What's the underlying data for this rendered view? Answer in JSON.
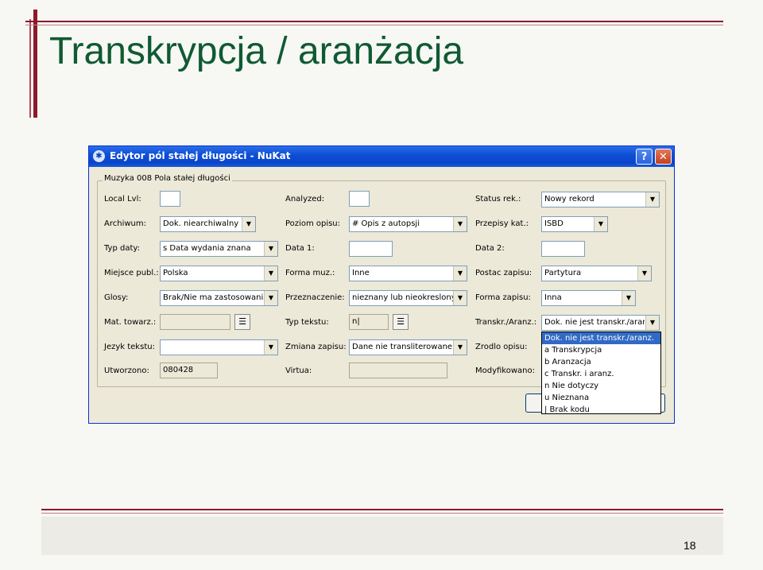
{
  "slide": {
    "title": "Transkrypcja / aranżacja",
    "page_number": "18"
  },
  "window": {
    "title": "Edytor pól stałej długości - NuKat",
    "help_label": "?",
    "close_label": "✕",
    "icon": "app-icon"
  },
  "form": {
    "group_label": "Muzyka 008 Pola stałej długości",
    "local_lvl": {
      "label": "Local Lvl:",
      "value": ""
    },
    "analyzed": {
      "label": "Analyzed:",
      "value": ""
    },
    "status_rek": {
      "label": "Status rek.:",
      "value": "Nowy rekord"
    },
    "archiwum": {
      "label": "Archiwum:",
      "value": "Dok. niearchiwalny"
    },
    "poziom_opisu": {
      "label": "Poziom opisu:",
      "value": "# Opis z autopsji"
    },
    "przepisy_kat": {
      "label": "Przepisy kat.:",
      "value": "ISBD"
    },
    "typ_daty": {
      "label": "Typ daty:",
      "value": "s Data wydania znana"
    },
    "data1": {
      "label": "Data 1:",
      "value": ""
    },
    "data2": {
      "label": "Data 2:",
      "value": ""
    },
    "miejsce_publ": {
      "label": "Miejsce publ.:",
      "value": "Polska"
    },
    "forma_muz": {
      "label": "Forma muz.:",
      "value": "Inne"
    },
    "postac_zapisu": {
      "label": "Postac zapisu:",
      "value": "Partytura"
    },
    "glosy": {
      "label": "Glosy:",
      "value": "Brak/Nie ma zastosowania"
    },
    "przeznaczenie": {
      "label": "Przeznaczenie:",
      "value": "nieznany lub nieokreslony"
    },
    "forma_zapisu": {
      "label": "Forma zapisu:",
      "value": "Inna"
    },
    "mat_towarz": {
      "label": "Mat. towarz.:",
      "value": ""
    },
    "typ_tekstu": {
      "label": "Typ tekstu:",
      "value": "n|"
    },
    "transkr_aranz": {
      "label": "Transkr./Aranz.:",
      "value": "Dok. nie jest transkr./aranz"
    },
    "jezyk_tekstu": {
      "label": "Jezyk tekstu:",
      "value": ""
    },
    "zmiana_zapisu": {
      "label": "Zmiana zapisu:",
      "value": "Dane nie transliterowane"
    },
    "zrodlo_opisu": {
      "label": "Zrodlo opisu:"
    },
    "utworzono": {
      "label": "Utworzono:",
      "value": "080428"
    },
    "virtua": {
      "label": "Virtua:",
      "value": ""
    },
    "modyfikowano": {
      "label": "Modyfikowano:"
    },
    "list_icon": "list-editor-icon"
  },
  "transkr_options": [
    "Dok. nie jest transkr./aranz.",
    "a Transkrypcja",
    "b Aranzacja",
    "c Transkr. i aranz.",
    "n Nie dotyczy",
    "u Nieznana",
    "| Brak kodu"
  ],
  "colors": {
    "title": "#0f5a32",
    "accent": "#8c1a2a",
    "xp_blue": "#0a45c9",
    "selection": "#316ac5"
  }
}
